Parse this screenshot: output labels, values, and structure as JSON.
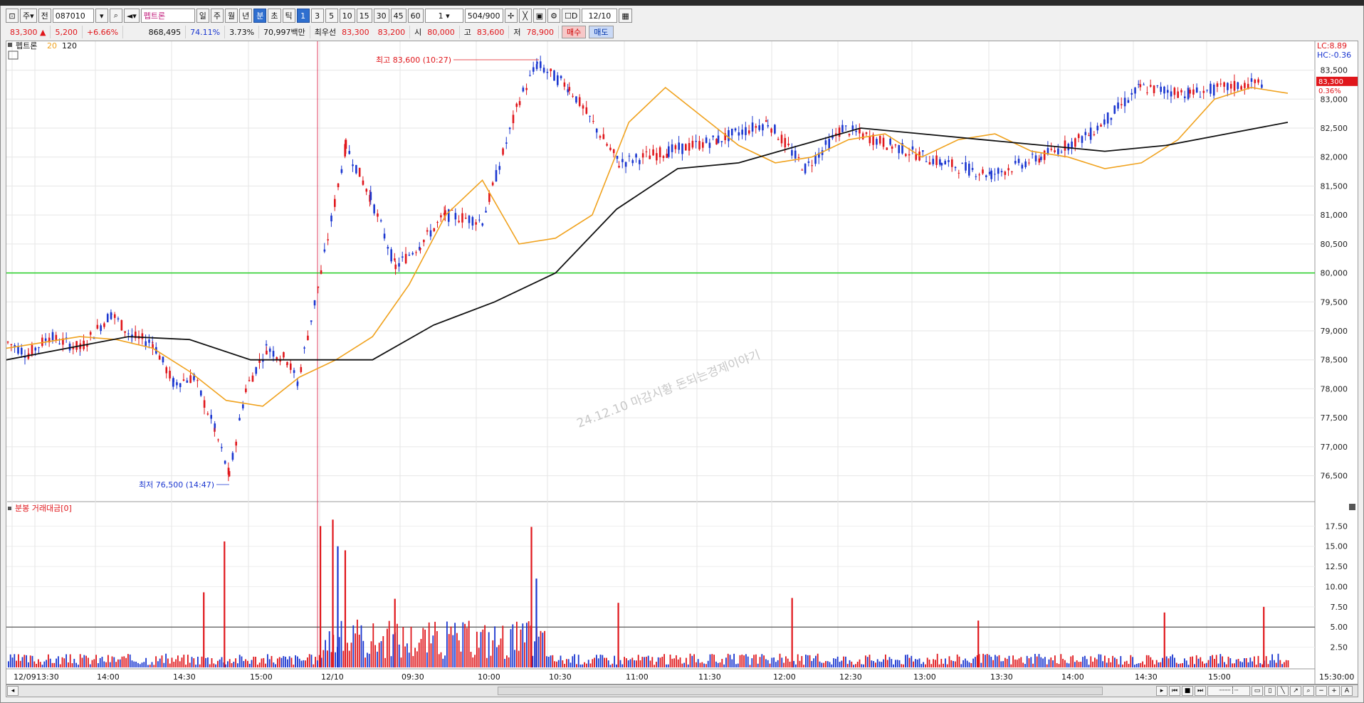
{
  "toolbar": {
    "period_label": "주",
    "market_label": "전",
    "stock_code": "087010",
    "stock_name": "펩트론",
    "tab_day": "일",
    "tab_week": "주",
    "tab_month": "월",
    "tab_year": "년",
    "tab_minute": "분",
    "tab_second": "초",
    "tab_tick": "틱",
    "intervals": [
      "1",
      "3",
      "5",
      "10",
      "15",
      "30",
      "45",
      "60"
    ],
    "interval_value": "1",
    "view_count": "504",
    "view_total": "/900",
    "date_checkbox_label": "D",
    "date_value": "12/10"
  },
  "quote": {
    "price": "83,300",
    "change": "5,200",
    "change_pct": "+6.66%",
    "volume": "868,495",
    "ratio1": "74.11%",
    "ratio2": "3.73%",
    "amount": "70,997백만",
    "best_bid_label": "최우선",
    "best_ask": "83,300",
    "best_bid": "83,200",
    "open_label": "시",
    "open": "80,000",
    "high_label": "고",
    "high": "83,600",
    "low_label": "저",
    "low": "78,900",
    "buy_label": "매수",
    "sell_label": "매도"
  },
  "price_pane": {
    "legend_name": "펩트론",
    "ma_short": "20",
    "ma_long": "120",
    "high_annotation": "최고 83,600 (10:27)",
    "low_annotation": "최저 76,500 (14:47)",
    "lc_label": "LC:8.89",
    "hc_label": "HC:-0.36",
    "current_price_tag": "83,300",
    "current_pct_tag": "0.36%",
    "watermark": "24.12.10 마감시황 돈되는경제이야기",
    "reference_price": 80000
  },
  "volume_pane": {
    "legend": "분봉 거래대금[0]",
    "reference_value": 5.0
  },
  "colors": {
    "up": "#e0161b",
    "down": "#1a36d0",
    "ma20": "#f0a21e",
    "ma120": "#111111",
    "ref_line": "#22cc22"
  },
  "chart_data": {
    "type": "candlestick-intraday",
    "price_axis": {
      "ylim": [
        76200,
        83900
      ],
      "ticks": [
        "83,500",
        "83,000",
        "82,500",
        "82,000",
        "81,500",
        "81,000",
        "80,500",
        "80,000",
        "79,500",
        "79,000",
        "78,500",
        "78,000",
        "77,500",
        "77,000",
        "76,500"
      ]
    },
    "volume_axis": {
      "ylim": [
        0,
        18.5
      ],
      "ticks": [
        "17.50",
        "15.00",
        "12.50",
        "10.00",
        "7.50",
        "5.00",
        "2.50"
      ]
    },
    "time_labels": [
      "12/09",
      "13:30",
      "14:00",
      "14:30",
      "15:00",
      "12/10",
      "09:30",
      "10:00",
      "10:30",
      "11:00",
      "11:30",
      "12:00",
      "12:30",
      "13:00",
      "13:30",
      "14:00",
      "14:30",
      "15:00",
      "15:30:00"
    ],
    "price_series": {
      "name": "펩트론",
      "points": [
        {
          "t": "12/09 13:00",
          "close": 78800
        },
        {
          "t": "12/09 13:10",
          "close": 78600
        },
        {
          "t": "12/09 13:20",
          "close": 78900
        },
        {
          "t": "12/09 13:35",
          "close": 78700
        },
        {
          "t": "12/09 13:50",
          "close": 79300
        },
        {
          "t": "12/09 14:00",
          "close": 78900
        },
        {
          "t": "12/09 14:10",
          "close": 78800
        },
        {
          "t": "12/09 14:20",
          "close": 78100
        },
        {
          "t": "12/09 14:30",
          "close": 78200
        },
        {
          "t": "12/09 14:40",
          "close": 77300
        },
        {
          "t": "12/09 14:47",
          "close": 76500
        },
        {
          "t": "12/09 14:55",
          "close": 78000
        },
        {
          "t": "12/09 15:05",
          "close": 78700
        },
        {
          "t": "12/09 15:15",
          "close": 78500
        },
        {
          "t": "12/09 15:20",
          "close": 78100
        },
        {
          "t": "12/10 09:00",
          "close": 80000
        },
        {
          "t": "12/10 09:10",
          "close": 82200
        },
        {
          "t": "12/10 09:20",
          "close": 81300
        },
        {
          "t": "12/10 09:30",
          "close": 80100
        },
        {
          "t": "12/10 09:40",
          "close": 80500
        },
        {
          "t": "12/10 09:50",
          "close": 81000
        },
        {
          "t": "12/10 10:05",
          "close": 80900
        },
        {
          "t": "12/10 10:20",
          "close": 83000
        },
        {
          "t": "12/10 10:27",
          "close": 83600
        },
        {
          "t": "12/10 10:40",
          "close": 83200
        },
        {
          "t": "12/10 11:00",
          "close": 81900
        },
        {
          "t": "12/10 11:20",
          "close": 82100
        },
        {
          "t": "12/10 11:40",
          "close": 82300
        },
        {
          "t": "12/10 12:00",
          "close": 82600
        },
        {
          "t": "12/10 12:15",
          "close": 81800
        },
        {
          "t": "12/10 12:30",
          "close": 82500
        },
        {
          "t": "12/10 12:50",
          "close": 82200
        },
        {
          "t": "12/10 13:10",
          "close": 81900
        },
        {
          "t": "12/10 13:30",
          "close": 81700
        },
        {
          "t": "12/10 13:50",
          "close": 82000
        },
        {
          "t": "12/10 14:10",
          "close": 82400
        },
        {
          "t": "12/10 14:30",
          "close": 83200
        },
        {
          "t": "12/10 14:50",
          "close": 83100
        },
        {
          "t": "12/10 15:20",
          "close": 83300
        }
      ]
    },
    "ma20": [
      78700,
      78800,
      78900,
      78850,
      78700,
      78300,
      77800,
      77700,
      78200,
      78500,
      78900,
      79800,
      81000,
      81600,
      80500,
      80600,
      81000,
      82600,
      83200,
      82700,
      82200,
      81900,
      82000,
      82300,
      82400,
      82000,
      82300,
      82400,
      82100,
      82000,
      81800,
      81900,
      82300,
      83000,
      83200,
      83100
    ],
    "ma120": [
      78500,
      78700,
      78900,
      78850,
      78500,
      78500,
      78500,
      79100,
      79500,
      80000,
      81100,
      81800,
      81900,
      82200,
      82500,
      82400,
      82300,
      82200,
      82100,
      82200,
      82400,
      82600
    ],
    "volume_bars": [
      {
        "t": "12/09 14:35",
        "value": 9.3
      },
      {
        "t": "12/09 14:45",
        "value": 15.6
      },
      {
        "t": "12/10 09:00",
        "value": 17.5
      },
      {
        "t": "12/10 09:05",
        "value": 18.3
      },
      {
        "t": "12/10 09:07",
        "value": 15.0
      },
      {
        "t": "12/10 09:10",
        "value": 14.5
      },
      {
        "t": "12/10 09:30",
        "value": 8.5
      },
      {
        "t": "12/10 10:25",
        "value": 17.4
      },
      {
        "t": "12/10 10:27",
        "value": 11.0
      },
      {
        "t": "12/10 11:00",
        "value": 8.0
      },
      {
        "t": "12/10 12:10",
        "value": 8.6
      },
      {
        "t": "12/10 13:25",
        "value": 5.8
      },
      {
        "t": "12/10 14:40",
        "value": 6.8
      },
      {
        "t": "12/10 15:20",
        "value": 7.5
      }
    ]
  }
}
